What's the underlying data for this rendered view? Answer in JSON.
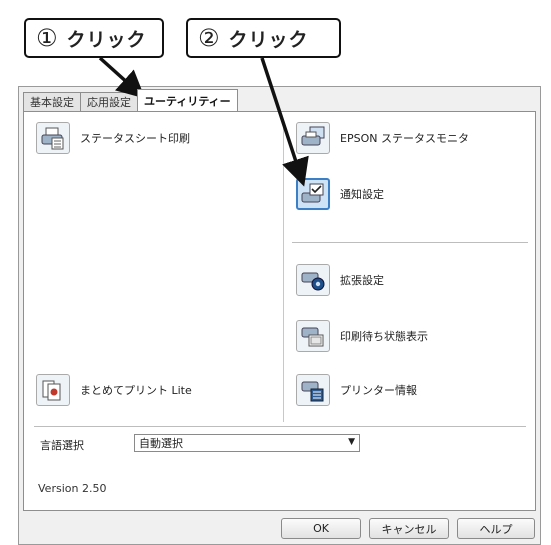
{
  "callouts": [
    {
      "num": "①",
      "label": "クリック"
    },
    {
      "num": "②",
      "label": "クリック"
    }
  ],
  "tabs": [
    "基本設定",
    "応用設定",
    "ユーティリティー"
  ],
  "active_tab": "ユーティリティー",
  "utilities": {
    "status_sheet": "ステータスシート印刷",
    "epson_monitor": "EPSON ステータスモニタ",
    "notification": "通知設定",
    "extended": "拡張設定",
    "print_queue": "印刷待ち状態表示",
    "matomete": "まとめてプリント Lite",
    "printer_info": "プリンター情報"
  },
  "language": {
    "label": "言語選択",
    "selected": "自動選択"
  },
  "version": "Version 2.50",
  "buttons": {
    "ok": "OK",
    "cancel": "キャンセル",
    "help": "ヘルプ"
  }
}
